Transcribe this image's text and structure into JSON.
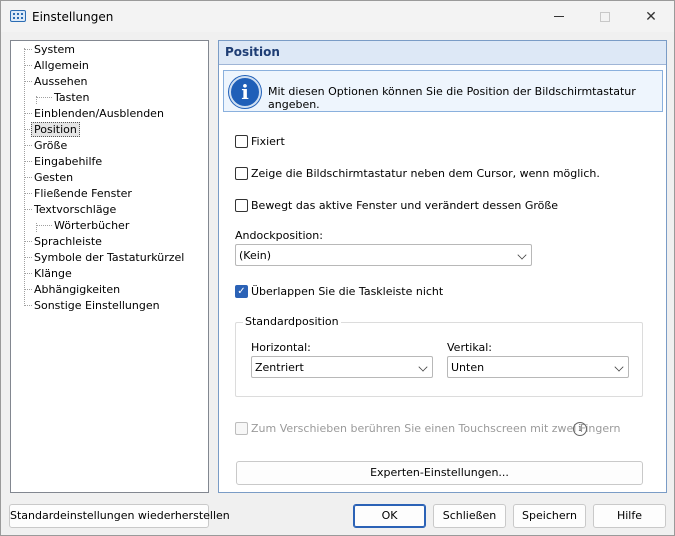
{
  "window": {
    "title": "Einstellungen",
    "minimize": "minimize-icon",
    "maximize": "maximize-icon",
    "close": "close-icon",
    "close_glyph": "✕"
  },
  "tree": {
    "items": [
      {
        "label": "System",
        "level": 0
      },
      {
        "label": "Allgemein",
        "level": 0
      },
      {
        "label": "Aussehen",
        "level": 0
      },
      {
        "label": "Tasten",
        "level": 1
      },
      {
        "label": "Einblenden/Ausblenden",
        "level": 0
      },
      {
        "label": "Position",
        "level": 0,
        "selected": true
      },
      {
        "label": "Größe",
        "level": 0
      },
      {
        "label": "Eingabehilfe",
        "level": 0
      },
      {
        "label": "Gesten",
        "level": 0
      },
      {
        "label": "Fließende Fenster",
        "level": 0
      },
      {
        "label": "Textvorschläge",
        "level": 0
      },
      {
        "label": "Wörterbücher",
        "level": 1
      },
      {
        "label": "Sprachleiste",
        "level": 0
      },
      {
        "label": "Symbole der Tastaturkürzel",
        "level": 0
      },
      {
        "label": "Klänge",
        "level": 0
      },
      {
        "label": "Abhängigkeiten",
        "level": 0
      },
      {
        "label": "Sonstige Einstellungen",
        "level": 0
      }
    ]
  },
  "panel": {
    "title": "Position",
    "info_icon": "info-icon",
    "info_glyph": "i",
    "info_text": "Mit diesen Optionen können Sie die Position der Bildschirmtastatur angeben.",
    "checkboxes": {
      "fixed": {
        "label": "Fixiert",
        "checked": false
      },
      "near_cursor": {
        "label": "Zeige die Bildschirmtastatur neben dem Cursor, wenn möglich.",
        "checked": false
      },
      "move_window": {
        "label": "Bewegt das aktive Fenster und verändert dessen Größe",
        "checked": false
      },
      "no_overlap": {
        "label": "Überlappen Sie die Taskleiste nicht",
        "checked": true
      },
      "touch_move": {
        "label": "Zum Verschieben berühren Sie einen Touchscreen mit zwei Fingern",
        "checked": false,
        "disabled": true
      }
    },
    "check_glyph": "✓",
    "dock": {
      "label": "Andockposition:",
      "value": "(Kein)"
    },
    "standard_position": {
      "title": "Standardposition",
      "horizontal": {
        "label": "Horizontal:",
        "value": "Zentriert"
      },
      "vertical": {
        "label": "Vertikal:",
        "value": "Unten"
      }
    },
    "help_glyph": "i",
    "expert_button": "Experten-Einstellungen..."
  },
  "footer": {
    "restore": "Standardeinstellungen wiederherstellen",
    "ok": "OK",
    "close": "Schließen",
    "save": "Speichern",
    "help": "Hilfe"
  }
}
